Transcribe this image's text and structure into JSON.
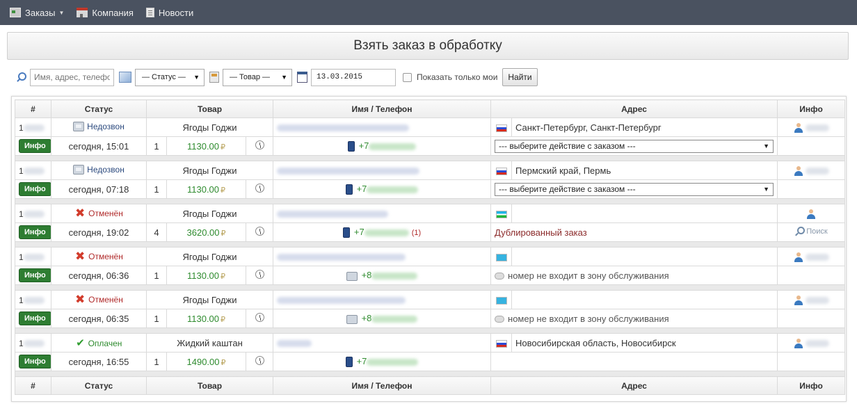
{
  "nav": {
    "orders": "Заказы",
    "company": "Компания",
    "news": "Новости"
  },
  "page_title": "Взять заказ в обработку",
  "filters": {
    "search_placeholder": "Имя, адрес, телефон",
    "status_selected": "— Статус —",
    "product_selected": "— Товар —",
    "date_value": "13.03.2015",
    "only_mine_label": "Показать только мои",
    "find_button": "Найти"
  },
  "table": {
    "headers": [
      "#",
      "Статус",
      "Товар",
      "Имя / Телефон",
      "Адрес",
      "Инфо"
    ],
    "info_button": "Инфо",
    "action_placeholder": "--- выберите действие с заказом ---",
    "orders": [
      {
        "id_prefix": "1",
        "status": "Недозвон",
        "status_type": "noanswer",
        "product": "Ягоды Годжи",
        "time": "сегодня, 15:01",
        "qty": "1",
        "price": "1130.00",
        "phone_prefix": "+7",
        "phone_type": "mobile",
        "flag": "ru",
        "address": "Санкт-Петербург, Санкт-Петербург",
        "has_action_select": true,
        "bottom_text": ""
      },
      {
        "id_prefix": "1",
        "status": "Недозвон",
        "status_type": "noanswer",
        "product": "Ягоды Годжи",
        "time": "сегодня, 07:18",
        "qty": "1",
        "price": "1130.00",
        "phone_prefix": "+7",
        "phone_type": "mobile",
        "flag": "ru",
        "address": "Пермский край, Пермь",
        "has_action_select": true,
        "bottom_text": ""
      },
      {
        "id_prefix": "1",
        "status": "Отменён",
        "status_type": "cancelled",
        "product": "Ягоды Годжи",
        "time": "сегодня, 19:02",
        "qty": "4",
        "price": "3620.00",
        "phone_prefix": "+7",
        "phone_type": "mobile",
        "phone_count": "(1)",
        "flag": "uz",
        "address": "",
        "has_action_select": false,
        "bottom_text": "Дублированный заказ",
        "search_link": "Поиск"
      },
      {
        "id_prefix": "1",
        "status": "Отменён",
        "status_type": "cancelled",
        "product": "Ягоды Годжи",
        "time": "сегодня, 06:36",
        "qty": "1",
        "price": "1130.00",
        "phone_prefix": "+8",
        "phone_type": "landline",
        "flag": "kz",
        "address": "",
        "has_action_select": false,
        "bottom_text": "номер не входит в зону обслуживания"
      },
      {
        "id_prefix": "1",
        "status": "Отменён",
        "status_type": "cancelled",
        "product": "Ягоды Годжи",
        "time": "сегодня, 06:35",
        "qty": "1",
        "price": "1130.00",
        "phone_prefix": "+8",
        "phone_type": "landline",
        "flag": "kz",
        "address": "",
        "has_action_select": false,
        "bottom_text": "номер не входит в зону обслуживания"
      },
      {
        "id_prefix": "1",
        "status": "Оплачен",
        "status_type": "paid",
        "product": "Жидкий каштан",
        "time": "сегодня, 16:55",
        "qty": "1",
        "price": "1490.00",
        "phone_prefix": "+7",
        "phone_type": "mobile",
        "flag": "ru",
        "address": "Новосибирская область, Новосибирск",
        "has_action_select": false,
        "bottom_text": ""
      }
    ]
  },
  "icons": {
    "nav_orders": "orders-icon",
    "nav_company": "company-icon",
    "nav_news": "news-icon",
    "search": "search-icon",
    "status_filter": "chart-icon",
    "product_filter": "product-icon",
    "calendar": "calendar-icon",
    "status_noanswer": "phone-icon",
    "status_cancelled": "cross-icon",
    "status_paid": "check-icon",
    "time": "clock-icon",
    "user": "user-icon"
  },
  "colors": {
    "nav_bg": "#4a5260",
    "info_button": "#2e7d32",
    "price": "#2e8b2e",
    "cancelled": "#d23c2c",
    "paid": "#2f9d2f"
  }
}
